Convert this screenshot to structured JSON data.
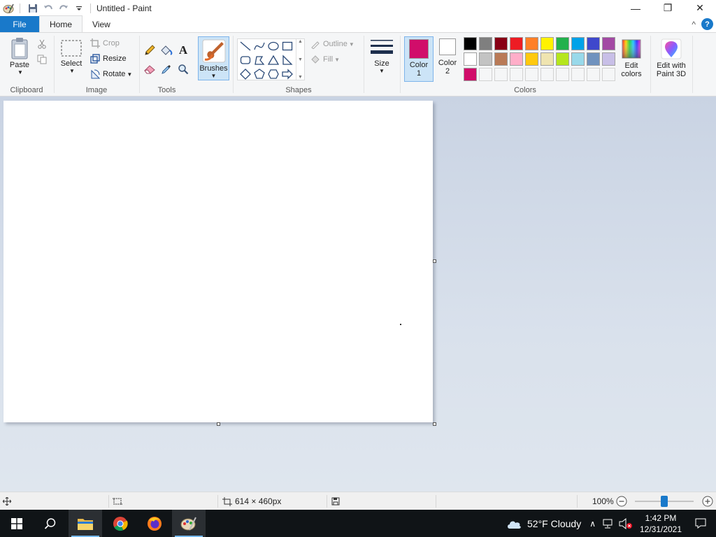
{
  "window": {
    "title": "Untitled - Paint",
    "minimize_glyph": "—",
    "restore_glyph": "❐",
    "close_glyph": "✕"
  },
  "tabs": {
    "file": "File",
    "home": "Home",
    "view": "View",
    "help_glyph": "?",
    "collapse_glyph": "^"
  },
  "clipboard": {
    "paste": "Paste",
    "group_label": "Clipboard"
  },
  "image": {
    "select": "Select",
    "crop": "Crop",
    "resize": "Resize",
    "rotate": "Rotate",
    "group_label": "Image"
  },
  "tools": {
    "text_glyph": "A",
    "group_label": "Tools"
  },
  "brushes": {
    "label": "Brushes"
  },
  "shapes": {
    "outline": "Outline",
    "fill": "Fill",
    "group_label": "Shapes"
  },
  "size": {
    "label": "Size"
  },
  "colors": {
    "color1_line1": "Color",
    "color1_line2": "1",
    "color2_line1": "Color",
    "color2_line2": "2",
    "color1": "#d10d6a",
    "color2": "#ffffff",
    "edit_line1": "Edit",
    "edit_line2": "colors",
    "group_label": "Colors",
    "palette_row1": [
      "#000000",
      "#7f7f7f",
      "#880015",
      "#ed1c24",
      "#ff7f27",
      "#fff200",
      "#22b14c",
      "#00a2e8",
      "#3f48cc",
      "#a349a4"
    ],
    "palette_row2": [
      "#ffffff",
      "#c3c3c3",
      "#b97a57",
      "#ffaec9",
      "#ffc90e",
      "#efe4b0",
      "#b5e61d",
      "#99d9ea",
      "#7092be",
      "#c8bfe7"
    ],
    "palette_row3": [
      "#d10d6a"
    ]
  },
  "paint3d": {
    "line1": "Edit with",
    "line2": "Paint 3D"
  },
  "status": {
    "canvas_size": "614 × 460px",
    "zoom": "100%",
    "zoom_level": 0.5
  },
  "taskbar": {
    "weather": "52°F  Cloudy",
    "time": "1:42 PM",
    "date": "12/31/2021"
  }
}
